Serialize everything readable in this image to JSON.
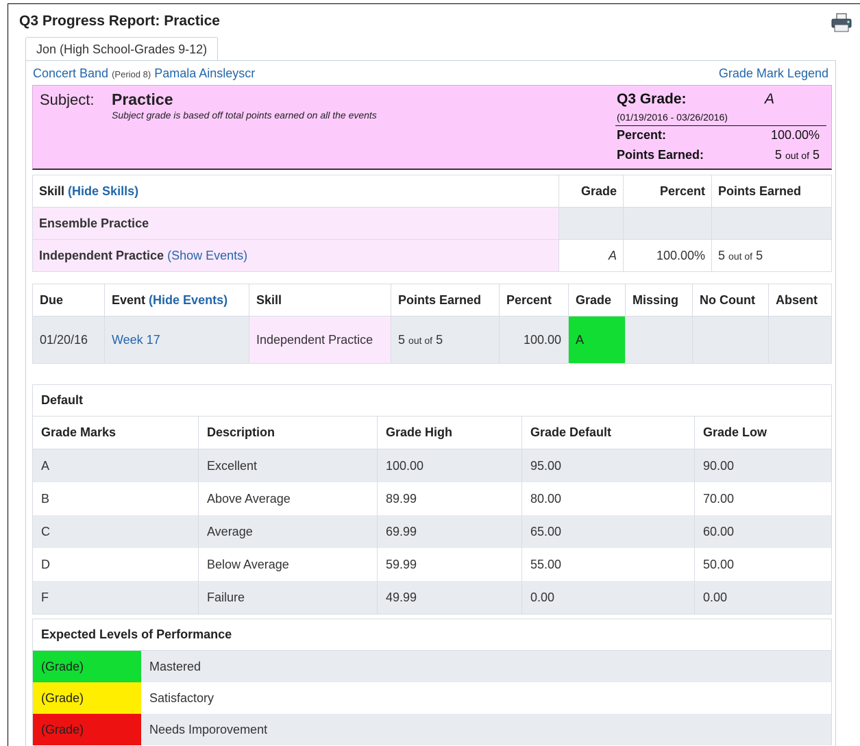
{
  "page": {
    "title": "Q3 Progress Report: Practice",
    "student_tab": "Jon (High School-Grades 9-12)"
  },
  "class_line": {
    "course": "Concert Band",
    "period": "(Period 8)",
    "teacher": "Pamala Ainsleyscr",
    "legend_link": "Grade Mark Legend"
  },
  "subject": {
    "label": "Subject:",
    "name": "Practice",
    "note": "Subject grade is based off total points earned on all the events",
    "term_label": "Q3 Grade:",
    "term_grade": "A",
    "dates": "(01/19/2016 - 03/26/2016)",
    "percent_label": "Percent:",
    "percent_value": "100.00%",
    "points_label": "Points Earned:",
    "points_earned": "5",
    "points_sep": "out of",
    "points_total": "5"
  },
  "skills": {
    "header_skill": "Skill",
    "hide_skills": "(Hide Skills)",
    "header_grade": "Grade",
    "header_percent": "Percent",
    "header_points": "Points Earned",
    "row1_name": "Ensemble Practice",
    "row2_name": "Independent Practice",
    "row2_show_events": "(Show Events)",
    "row2_grade": "A",
    "row2_percent": "100.00%",
    "row2_points": "5",
    "row2_sep": "out of",
    "row2_total": "5"
  },
  "events": {
    "headers": {
      "due": "Due",
      "event": "Event",
      "hide_events": "(Hide Events)",
      "skill": "Skill",
      "points": "Points Earned",
      "percent": "Percent",
      "grade": "Grade",
      "missing": "Missing",
      "nocount": "No Count",
      "absent": "Absent"
    },
    "row": {
      "due": "01/20/16",
      "event": "Week 17",
      "skill": "Independent Practice",
      "points": "5",
      "sep": "out of",
      "total": "5",
      "percent": "100.00",
      "grade": "A",
      "grade_color": "#11dd33"
    }
  },
  "marks": {
    "title": "Default",
    "headers": [
      "Grade Marks",
      "Description",
      "Grade High",
      "Grade Default",
      "Grade Low"
    ],
    "rows": [
      [
        "A",
        "Excellent",
        "100.00",
        "95.00",
        "90.00"
      ],
      [
        "B",
        "Above Average",
        "89.99",
        "80.00",
        "70.00"
      ],
      [
        "C",
        "Average",
        "69.99",
        "65.00",
        "60.00"
      ],
      [
        "D",
        "Below Average",
        "59.99",
        "55.00",
        "50.00"
      ],
      [
        "F",
        "Failure",
        "49.99",
        "0.00",
        "0.00"
      ]
    ]
  },
  "performance": {
    "title": "Expected Levels of Performance",
    "levels": [
      {
        "swatch": "(Grade)",
        "label": "Mastered",
        "color": "#11dd33"
      },
      {
        "swatch": "(Grade)",
        "label": "Satisfactory",
        "color": "#ffee00"
      },
      {
        "swatch": "(Grade)",
        "label": "Needs Imporovement",
        "color": "#ee1111"
      }
    ]
  },
  "icons": {
    "printer": "printer-icon"
  }
}
